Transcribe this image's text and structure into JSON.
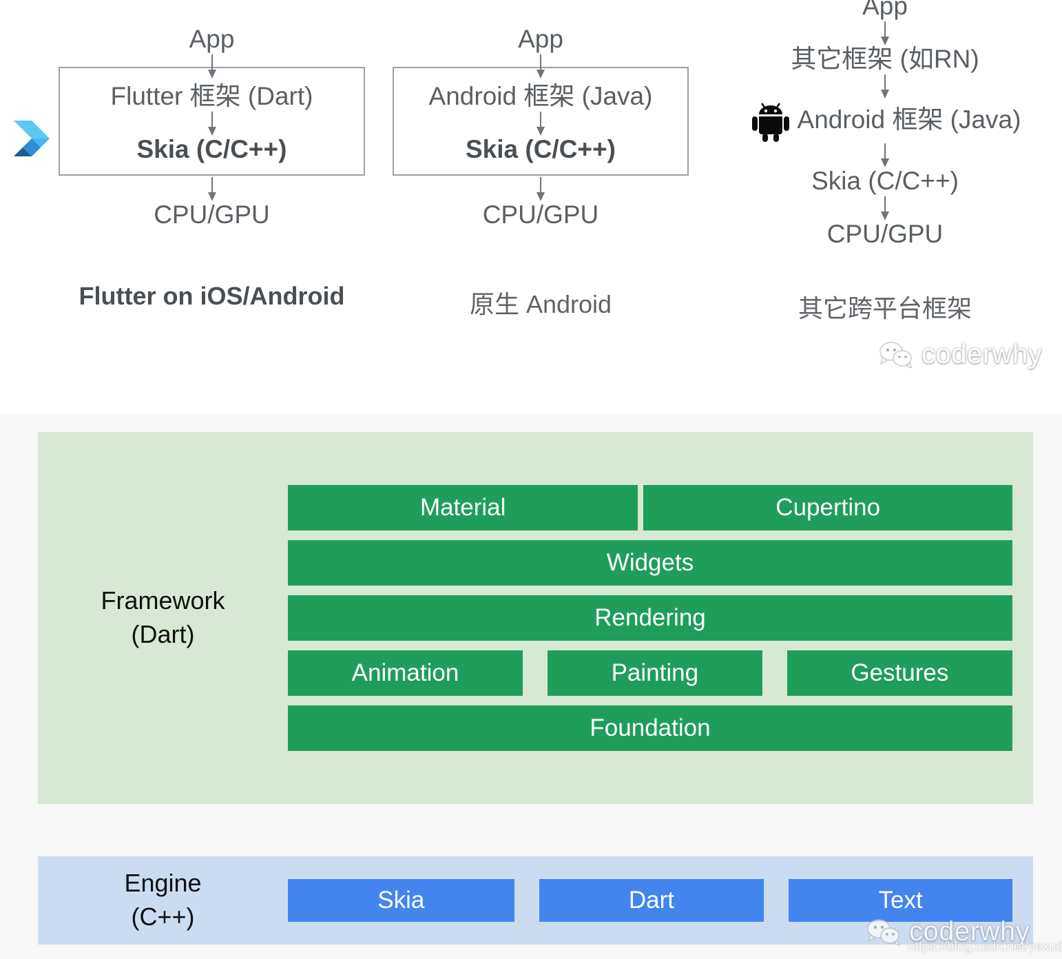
{
  "top_section": {
    "columns": [
      {
        "id": "flutter",
        "top_label": "App",
        "box_lines": [
          "Flutter 框架 (Dart)",
          "Skia (C/C++)"
        ],
        "bottom_label": "CPU/GPU",
        "caption": "Flutter on iOS/Android",
        "side_icon": "flutter-logo"
      },
      {
        "id": "native-android",
        "top_label": "App",
        "box_lines": [
          "Android 框架 (Java)",
          "Skia (C/C++)"
        ],
        "bottom_label": "CPU/GPU",
        "caption": "原生 Android",
        "side_icon": "android-robot-icon"
      },
      {
        "id": "other-cross-platform",
        "top_label": "App",
        "chain": [
          "其它框架 (如RN)",
          "Android 框架 (Java)",
          "Skia (C/C++)",
          "CPU/GPU"
        ],
        "caption": "其它跨平台框架",
        "side_icon": "android-robot-icon"
      }
    ]
  },
  "architecture": {
    "framework": {
      "title_line1": "Framework",
      "title_line2": "(Dart)",
      "rows": [
        {
          "bars": [
            {
              "label": "Material",
              "flex": 1
            },
            {
              "label": "Cupertino",
              "flex": 1
            }
          ]
        },
        {
          "bars": [
            {
              "label": "Widgets",
              "flex": 1
            }
          ]
        },
        {
          "bars": [
            {
              "label": "Rendering",
              "flex": 1
            }
          ]
        },
        {
          "bars": [
            {
              "label": "Animation",
              "flex": 1
            },
            {
              "label": "Painting",
              "flex": 1
            },
            {
              "label": "Gestures",
              "flex": 1
            }
          ]
        },
        {
          "bars": [
            {
              "label": "Foundation",
              "flex": 1
            }
          ]
        }
      ]
    },
    "engine": {
      "title_line1": "Engine",
      "title_line2": "(C++)",
      "rows": [
        {
          "bars": [
            {
              "label": "Skia",
              "flex": 1
            },
            {
              "label": "Dart",
              "flex": 1
            },
            {
              "label": "Text",
              "flex": 1
            }
          ]
        }
      ]
    }
  },
  "watermarks": {
    "brand": "coderwhy",
    "url": "https://blog.csdn.net/yexudengzhidao"
  },
  "colors": {
    "framework_panel_bg": "#d7e8d4",
    "framework_bar": "#1e9e5a",
    "engine_panel_bg": "#ccdcf0",
    "engine_bar": "#4285ee",
    "section_bg": "#f8f8f9",
    "box_border": "#9aa0a6",
    "arrow": "#6f757a",
    "text_gray": "#5a5f63"
  }
}
